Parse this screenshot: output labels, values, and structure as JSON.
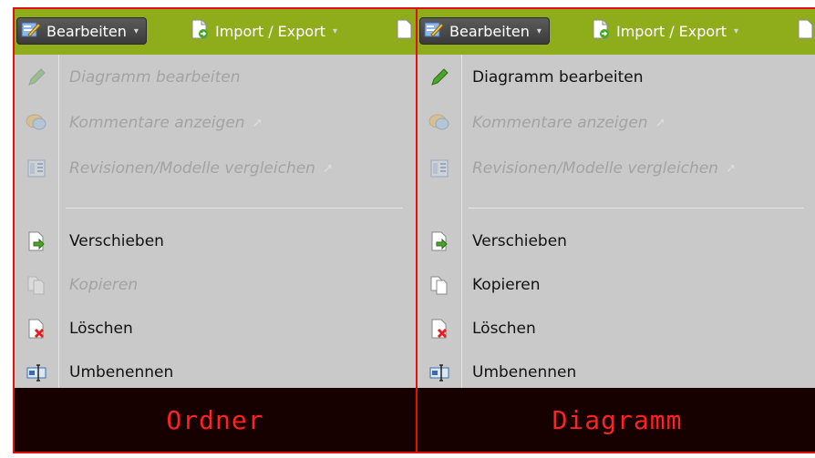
{
  "toolbar": {
    "edit_label": "Bearbeiten",
    "import_export_label": "Import / Export",
    "caret": "▾"
  },
  "left_panel": {
    "items": [
      {
        "label": "Diagramm bearbeiten",
        "icon": "pencil-icon",
        "enabled": false
      },
      {
        "label": "Kommentare anzeigen",
        "icon": "comment-icon",
        "enabled": false,
        "submenu": true
      },
      {
        "label": "Revisionen/Modelle vergleichen",
        "icon": "compare-icon",
        "enabled": false,
        "submenu": true
      },
      {
        "label": "Verschieben",
        "icon": "move-document-icon",
        "enabled": true
      },
      {
        "label": "Kopieren",
        "icon": "copy-icon",
        "enabled": false
      },
      {
        "label": "Löschen",
        "icon": "delete-document-icon",
        "enabled": true
      },
      {
        "label": "Umbenennen",
        "icon": "rename-icon",
        "enabled": true
      }
    ],
    "caption": "Ordner"
  },
  "right_panel": {
    "items": [
      {
        "label": "Diagramm bearbeiten",
        "icon": "pencil-icon",
        "enabled": true
      },
      {
        "label": "Kommentare anzeigen",
        "icon": "comment-icon",
        "enabled": false,
        "submenu": true
      },
      {
        "label": "Revisionen/Modelle vergleichen",
        "icon": "compare-icon",
        "enabled": false,
        "submenu": true
      },
      {
        "label": "Verschieben",
        "icon": "move-document-icon",
        "enabled": true
      },
      {
        "label": "Kopieren",
        "icon": "copy-icon",
        "enabled": true
      },
      {
        "label": "Löschen",
        "icon": "delete-document-icon",
        "enabled": true
      },
      {
        "label": "Umbenennen",
        "icon": "rename-icon",
        "enabled": true
      }
    ],
    "caption": "Diagramm"
  },
  "submenu_arrow": "➚",
  "colors": {
    "toolbar": "#8fad1a",
    "menu_bg": "#c9c9c9",
    "highlight_border": "#e01010",
    "caption_text": "#ff2222",
    "caption_bg": "#160000"
  }
}
